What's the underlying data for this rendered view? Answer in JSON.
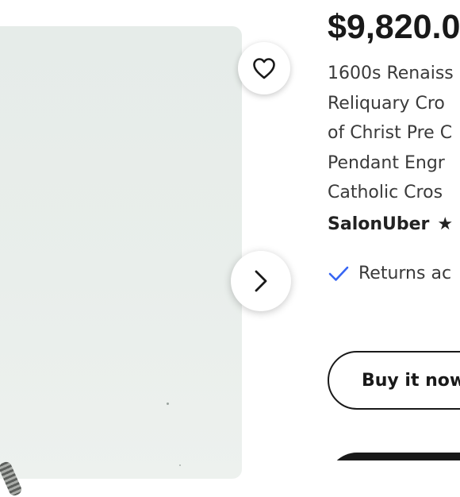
{
  "listing": {
    "price": "$9,820.0",
    "title_lines": [
      "1600s Renaiss",
      "Reliquary Cro",
      "of Christ Pre C",
      "Pendant Engr",
      "Catholic Cros"
    ],
    "seller_name": "SalonUber",
    "seller_stars": "★ ★",
    "returns_text": "Returns ac",
    "buy_now_label": "Buy it now"
  },
  "icons": {
    "favorite": "heart-icon",
    "next": "chevron-right-icon",
    "returns": "checkmark-icon"
  },
  "colors": {
    "text_primary": "#191919",
    "check_blue": "#3665f3",
    "photo_bg": "#e9eeeb"
  }
}
